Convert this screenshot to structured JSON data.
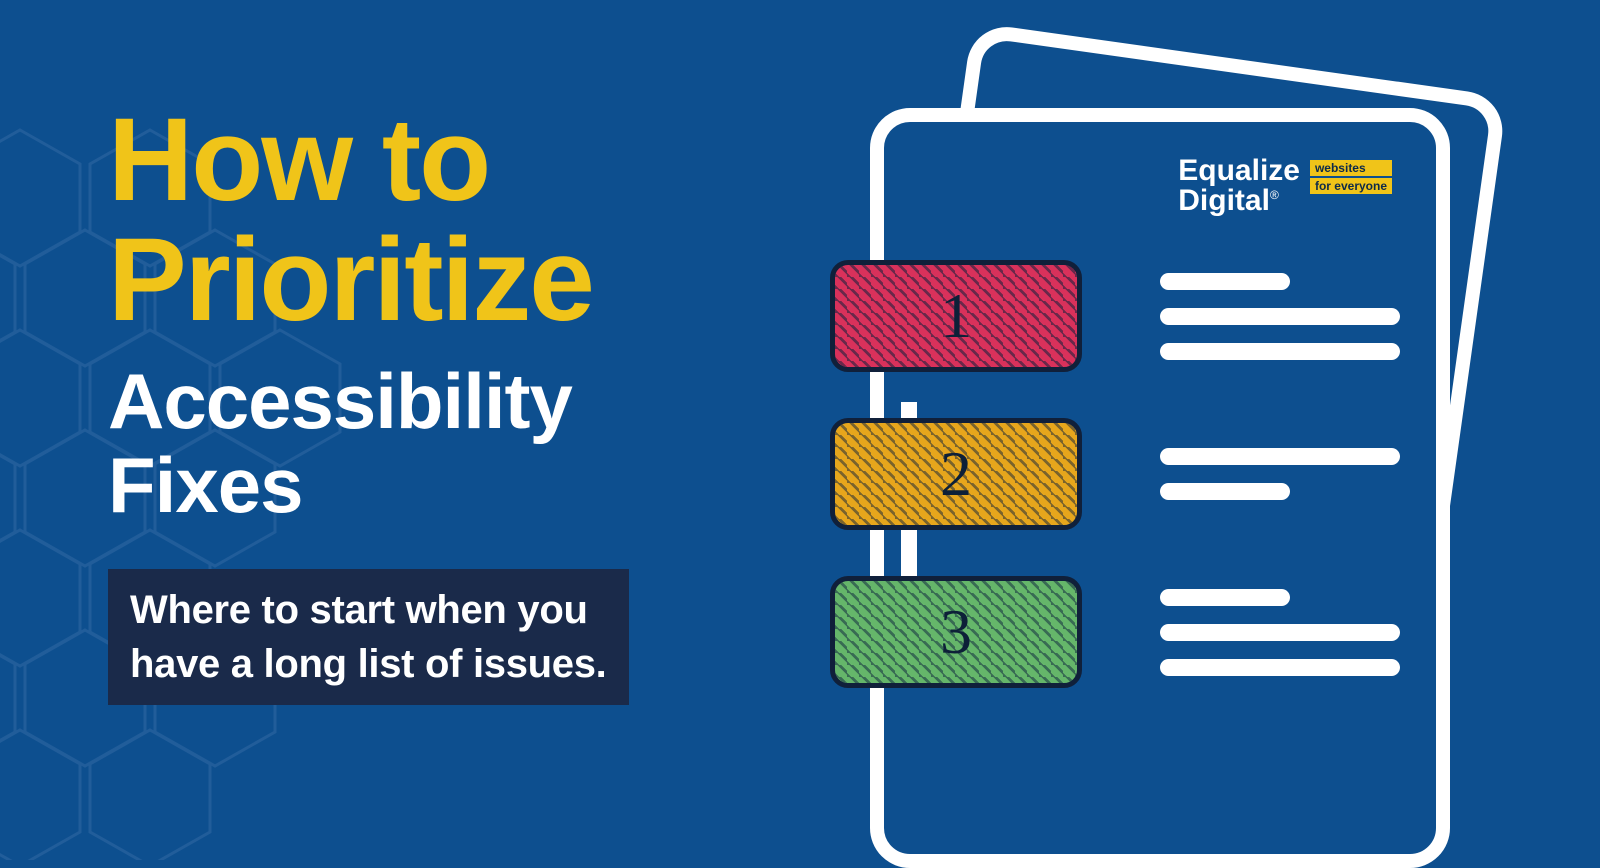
{
  "title": {
    "line1": "How to",
    "line2": "Prioritize",
    "white1": "Accessibility",
    "white2": "Fixes"
  },
  "subtitle": "Where to start when you\nhave a long list of issues.",
  "brand": {
    "name_line1": "Equalize",
    "name_line2": "Digital",
    "reg": "®",
    "tag1": "websites",
    "tag2": "for everyone"
  },
  "badges": {
    "n1": "1",
    "n2": "2",
    "n3": "3"
  },
  "colors": {
    "bg": "#0d4f8f",
    "yellow": "#f0c419",
    "darkbox": "#1a2a4a",
    "badge1": "#d9315b",
    "badge2": "#e7a61c",
    "badge3": "#65b66a"
  }
}
